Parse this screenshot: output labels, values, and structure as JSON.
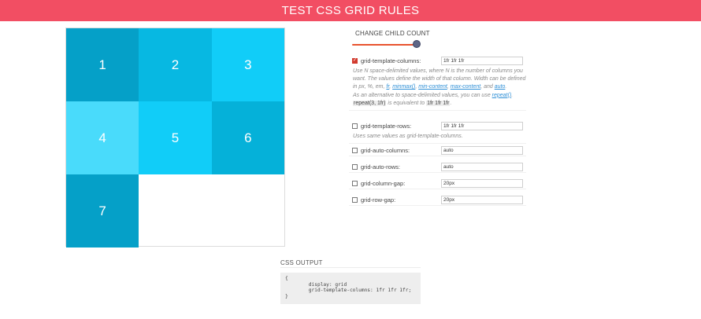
{
  "header": {
    "title": "TEST CSS GRID RULES"
  },
  "grid_items": [
    {
      "label": "1",
      "color": "#05a0c8"
    },
    {
      "label": "2",
      "color": "#07b8e2"
    },
    {
      "label": "3",
      "color": "#11cdf8"
    },
    {
      "label": "4",
      "color": "#49dbfb"
    },
    {
      "label": "5",
      "color": "#11cdf8"
    },
    {
      "label": "6",
      "color": "#05b1d9"
    },
    {
      "label": "7",
      "color": "#05a0c8"
    }
  ],
  "child_count": {
    "label": "CHANGE CHILD COUNT",
    "value_fraction": 1.0,
    "accent": "#e8532e"
  },
  "rules": [
    {
      "name": "grid-template-columns:",
      "value": "1fr 1fr 1fr",
      "checked": true,
      "description": [
        {
          "t": "Use N space-delimited values, where N is the number of columns you want. The values define the width of that column. Width can be defined in px, %, em, "
        },
        {
          "t": "fr",
          "link": true
        },
        {
          "t": ", "
        },
        {
          "t": "minmax()",
          "link": true
        },
        {
          "t": ", "
        },
        {
          "t": "min-content",
          "link": true
        },
        {
          "t": ", "
        },
        {
          "t": "max-content",
          "link": true
        },
        {
          "t": ", and "
        },
        {
          "t": "auto",
          "link": true
        },
        {
          "t": ".",
          "br": true
        },
        {
          "t": "As an alternative to space-delimited values, you can use "
        },
        {
          "t": "repeat()",
          "link": true
        },
        {
          "t": ". "
        },
        {
          "t": "repeat(3, 1fr)",
          "code": true
        },
        {
          "t": " is equivalent to "
        },
        {
          "t": "1fr 1fr 1fr",
          "code": true
        },
        {
          "t": "."
        }
      ]
    },
    {
      "name": "grid-template-rows:",
      "value": "1fr 1fr 1fr",
      "checked": false,
      "description": [
        {
          "t": "Uses same values as grid-template-columns."
        }
      ]
    },
    {
      "name": "grid-auto-columns:",
      "value": "auto",
      "checked": false
    },
    {
      "name": "grid-auto-rows:",
      "value": "auto",
      "checked": false
    },
    {
      "name": "grid-column-gap:",
      "value": "20px",
      "checked": false
    },
    {
      "name": "grid-row-gap:",
      "value": "20px",
      "checked": false
    }
  ],
  "css_output": {
    "title": "CSS OUTPUT",
    "lines": [
      "{",
      "        display: grid",
      "        grid-template-columns: 1fr 1fr 1fr;",
      "}"
    ]
  }
}
